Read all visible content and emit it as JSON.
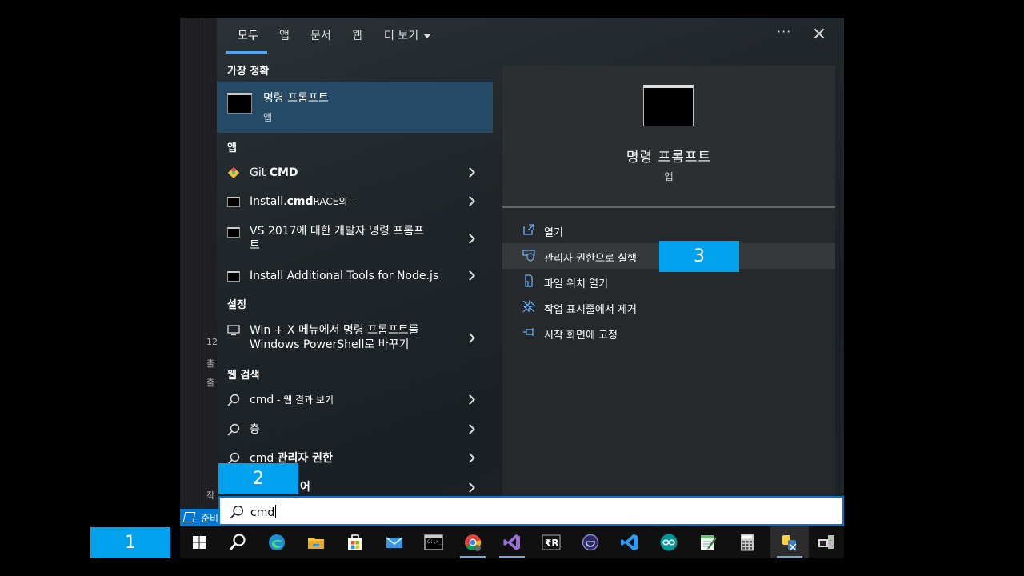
{
  "background": {
    "line_values": [
      "12",
      "출",
      "출",
      "작"
    ],
    "status_text": "준비"
  },
  "tabs": [
    {
      "label": "모두"
    },
    {
      "label": "앱"
    },
    {
      "label": "문서"
    },
    {
      "label": "웹"
    },
    {
      "label": "더 보기"
    }
  ],
  "header": {
    "more_label": "···"
  },
  "sections": {
    "best_match": "가장 정확",
    "apps": "앱",
    "settings": "설정",
    "web": "웹 검색"
  },
  "best_match": {
    "title": "명령 프롬프트",
    "subtitle": "앱"
  },
  "apps": [
    {
      "prefix": "Git ",
      "bold": "CMD",
      "suffix": "",
      "icon": "git-icon"
    },
    {
      "prefix": "Install.",
      "bold": "cmd",
      "suffix": "RACE의 -",
      "icon": "cmd-icon"
    },
    {
      "prefix": "VS 2017에 대한 개발자 명령 프롬프",
      "bold": "",
      "suffix": "트",
      "icon": "cmd-icon"
    },
    {
      "prefix": "Install Additional Tools for Node.js",
      "bold": "",
      "suffix": "",
      "icon": "cmd-icon"
    }
  ],
  "settings": [
    {
      "line1": "Win + X 메뉴에서 명령 프롬프트를",
      "line2": "Windows PowerShell로 바꾸기",
      "icon": "monitor-icon"
    }
  ],
  "web": [
    {
      "prefix": "cmd",
      "suffix": " - 웹 결과 보기"
    },
    {
      "prefix": "층",
      "suffix": ""
    },
    {
      "prefix": "cmd ",
      "suffix": "관리자 권한"
    },
    {
      "prefix": "",
      "suffix": "어"
    }
  ],
  "detail": {
    "title": "명령 프롬프트",
    "subtitle": "앱",
    "actions": [
      {
        "label": "열기",
        "icon": "open-icon"
      },
      {
        "label": "관리자 권한으로 실행",
        "icon": "shield-icon"
      },
      {
        "label": "파일 위치 열기",
        "icon": "file-location-icon"
      },
      {
        "label": "작업 표시줄에서 제거",
        "icon": "unpin-icon"
      },
      {
        "label": "시작 화면에 고정",
        "icon": "pin-icon"
      }
    ]
  },
  "search": {
    "value": "cmd"
  },
  "taskbar": [
    "windows-start-icon",
    "search-icon",
    "edge-icon",
    "file-explorer-icon",
    "store-icon",
    "mail-icon",
    "terminal-icon",
    "chrome-icon",
    "visual-studio-icon",
    "r-icon",
    "eclipse-icon",
    "vscode-icon",
    "arduino-icon",
    "notepad-icon",
    "calculator-icon",
    "python-icon",
    "remote-icon"
  ],
  "badges": [
    "1",
    "2",
    "3"
  ],
  "colors": {
    "accent": "#0078d4",
    "badge": "#00a2ed",
    "selected": "#254a66"
  }
}
